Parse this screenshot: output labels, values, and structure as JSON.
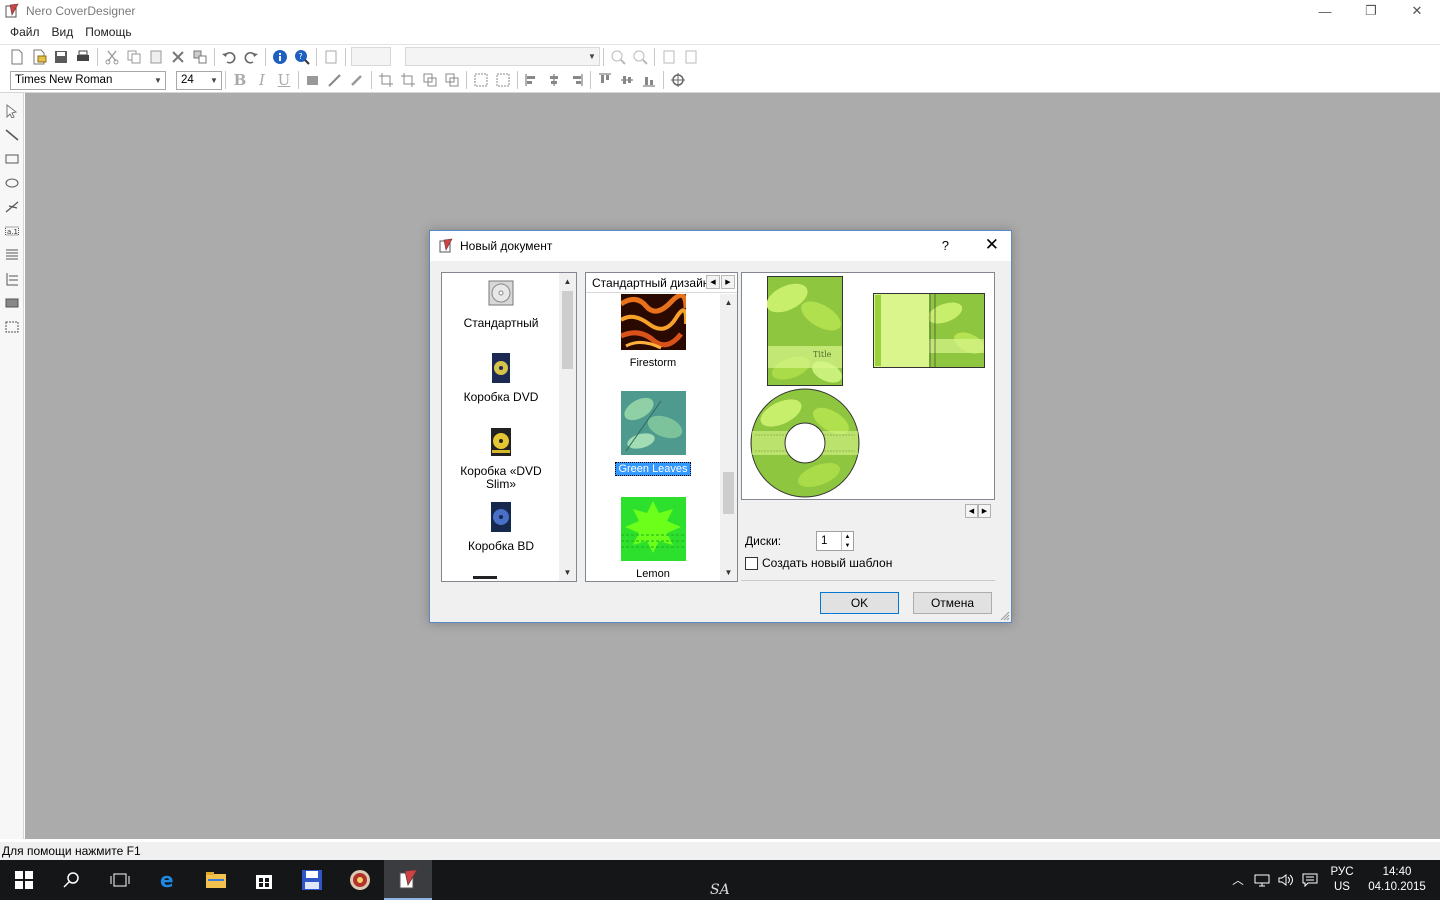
{
  "window": {
    "title": "Nero CoverDesigner",
    "minimize": "—",
    "restore": "❐",
    "close": "✕"
  },
  "menu": [
    "Файл",
    "Вид",
    "Помощь"
  ],
  "toolbar2": {
    "font": "Times New Roman",
    "size": "24"
  },
  "status": "Для помощи нажмите F1",
  "dialog": {
    "title": "Новый документ",
    "help": "?",
    "close": "✕",
    "project_types": [
      "Стандартный",
      "Коробка DVD",
      "Коробка «DVD Slim»",
      "Коробка BD"
    ],
    "tab_label": "Стандартный дизайн",
    "designs": [
      {
        "name": "Firestorm",
        "selected": false
      },
      {
        "name": "Green Leaves",
        "selected": true
      },
      {
        "name": "Lemon",
        "selected": false
      }
    ],
    "preview_title_text": "Title",
    "disks_label": "Диски:",
    "disks_value": "1",
    "new_template_label": "Создать новый шаблон",
    "new_template_checked": false,
    "ok": "OK",
    "cancel": "Отмена"
  },
  "taskbar": {
    "watermark": "SA",
    "lang_top": "РУС",
    "lang_bottom": "US",
    "time": "14:40",
    "date": "04.10.2015"
  },
  "colors": {
    "workspace": "#ababab",
    "taskbar": "#151618",
    "selection": "#3399ff",
    "leaf_green": "#9bd23c"
  }
}
